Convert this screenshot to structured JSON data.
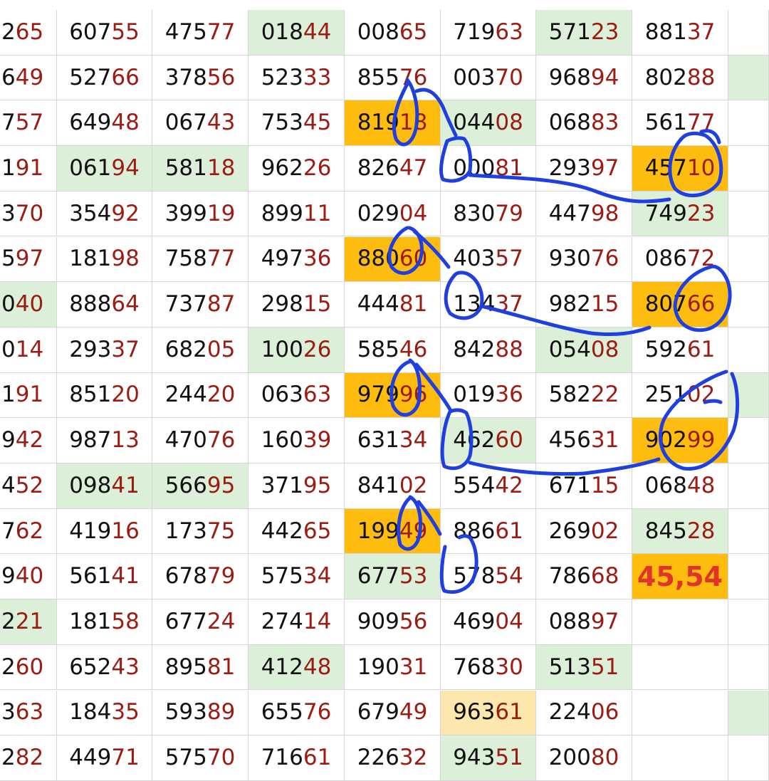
{
  "colors": {
    "highlight_orange": "#fdbc0e",
    "highlight_green": "#dcefd8",
    "highlight_yellow": "#fde7ac",
    "digit_dark": "#111111",
    "digit_red": "#9c1c14",
    "ink_blue": "#1f3fe0"
  },
  "rows": [
    [
      {
        "t": "265"
      },
      {
        "t": "60755"
      },
      {
        "t": "47577"
      },
      {
        "t": "01844",
        "bg": "g"
      },
      {
        "t": "00865"
      },
      {
        "t": "71963"
      },
      {
        "t": "57123",
        "bg": "g"
      },
      {
        "t": "88137"
      },
      {
        "t": ""
      }
    ],
    [
      {
        "t": "649"
      },
      {
        "t": "52766"
      },
      {
        "t": "37856"
      },
      {
        "t": "52333"
      },
      {
        "t": "85576"
      },
      {
        "t": "00370"
      },
      {
        "t": "96894"
      },
      {
        "t": "80288"
      },
      {
        "t": "",
        "bg": "g"
      }
    ],
    [
      {
        "t": "757"
      },
      {
        "t": "64948"
      },
      {
        "t": "06743"
      },
      {
        "t": "75345"
      },
      {
        "t": "81918",
        "bg": "o"
      },
      {
        "t": "04408",
        "bg": "g"
      },
      {
        "t": "06883"
      },
      {
        "t": "56177"
      },
      {
        "t": ""
      }
    ],
    [
      {
        "t": "191"
      },
      {
        "t": "06194",
        "bg": "g"
      },
      {
        "t": "58118",
        "bg": "g"
      },
      {
        "t": "96226"
      },
      {
        "t": "82647"
      },
      {
        "t": "00081"
      },
      {
        "t": "29397"
      },
      {
        "t": "45710",
        "bg": "o"
      },
      {
        "t": ""
      }
    ],
    [
      {
        "t": "370"
      },
      {
        "t": "35492"
      },
      {
        "t": "39919"
      },
      {
        "t": "89911"
      },
      {
        "t": "02904"
      },
      {
        "t": "83079"
      },
      {
        "t": "44798"
      },
      {
        "t": "74923",
        "bg": "g"
      },
      {
        "t": ""
      }
    ],
    [
      {
        "t": "597"
      },
      {
        "t": "18198"
      },
      {
        "t": "75877"
      },
      {
        "t": "49736"
      },
      {
        "t": "88060",
        "bg": "o"
      },
      {
        "t": "40357"
      },
      {
        "t": "93076"
      },
      {
        "t": "08672"
      },
      {
        "t": ""
      }
    ],
    [
      {
        "t": "040",
        "bg": "g"
      },
      {
        "t": "88864"
      },
      {
        "t": "73787"
      },
      {
        "t": "29815"
      },
      {
        "t": "44481"
      },
      {
        "t": "13437"
      },
      {
        "t": "98215"
      },
      {
        "t": "80766",
        "bg": "o"
      },
      {
        "t": ""
      }
    ],
    [
      {
        "t": "014"
      },
      {
        "t": "29337"
      },
      {
        "t": "68205"
      },
      {
        "t": "10026",
        "bg": "g"
      },
      {
        "t": "58546"
      },
      {
        "t": "84288"
      },
      {
        "t": "05408",
        "bg": "g"
      },
      {
        "t": "59261"
      },
      {
        "t": ""
      }
    ],
    [
      {
        "t": "191"
      },
      {
        "t": "85120"
      },
      {
        "t": "24420"
      },
      {
        "t": "06363"
      },
      {
        "t": "97996",
        "bg": "o"
      },
      {
        "t": "01936"
      },
      {
        "t": "58222"
      },
      {
        "t": "25102"
      },
      {
        "t": "",
        "bg": "g"
      }
    ],
    [
      {
        "t": "942"
      },
      {
        "t": "98713"
      },
      {
        "t": "47076"
      },
      {
        "t": "16039"
      },
      {
        "t": "63134"
      },
      {
        "t": "46260",
        "bg": "g"
      },
      {
        "t": "45631"
      },
      {
        "t": "90299",
        "bg": "o"
      },
      {
        "t": ""
      }
    ],
    [
      {
        "t": "452"
      },
      {
        "t": "09841",
        "bg": "g"
      },
      {
        "t": "56695",
        "bg": "g"
      },
      {
        "t": "37195"
      },
      {
        "t": "84102"
      },
      {
        "t": "55442"
      },
      {
        "t": "67115"
      },
      {
        "t": "06848"
      },
      {
        "t": ""
      }
    ],
    [
      {
        "t": "762"
      },
      {
        "t": "41916"
      },
      {
        "t": "17375"
      },
      {
        "t": "44265"
      },
      {
        "t": "19949",
        "bg": "o"
      },
      {
        "t": "88661"
      },
      {
        "t": "26902"
      },
      {
        "t": "84528",
        "bg": "g"
      },
      {
        "t": ""
      }
    ],
    [
      {
        "t": "940"
      },
      {
        "t": "56141"
      },
      {
        "t": "67879"
      },
      {
        "t": "57534"
      },
      {
        "t": "67753",
        "bg": "g"
      },
      {
        "t": "57854"
      },
      {
        "t": "78668"
      },
      {
        "t": "45,54",
        "bg": "o",
        "big": true
      },
      {
        "t": ""
      }
    ],
    [
      {
        "t": "221",
        "bg": "g"
      },
      {
        "t": "18158"
      },
      {
        "t": "67724"
      },
      {
        "t": "27414"
      },
      {
        "t": "90956"
      },
      {
        "t": "46904"
      },
      {
        "t": "08897"
      },
      {
        "t": ""
      },
      {
        "t": ""
      }
    ],
    [
      {
        "t": "260"
      },
      {
        "t": "65243"
      },
      {
        "t": "89581"
      },
      {
        "t": "41248",
        "bg": "g"
      },
      {
        "t": "19031"
      },
      {
        "t": "76830"
      },
      {
        "t": "51351",
        "bg": "g"
      },
      {
        "t": ""
      },
      {
        "t": ""
      }
    ],
    [
      {
        "t": "363"
      },
      {
        "t": "18435"
      },
      {
        "t": "59389"
      },
      {
        "t": "65576"
      },
      {
        "t": "67949"
      },
      {
        "t": "96361",
        "bg": "y"
      },
      {
        "t": "22406"
      },
      {
        "t": ""
      },
      {
        "t": "",
        "bg": "g"
      }
    ],
    [
      {
        "t": "282"
      },
      {
        "t": "44971"
      },
      {
        "t": "57570"
      },
      {
        "t": "71661"
      },
      {
        "t": "22632"
      },
      {
        "t": "94351",
        "bg": "g"
      },
      {
        "t": "20080"
      },
      {
        "t": ""
      },
      {
        "t": ""
      }
    ]
  ]
}
